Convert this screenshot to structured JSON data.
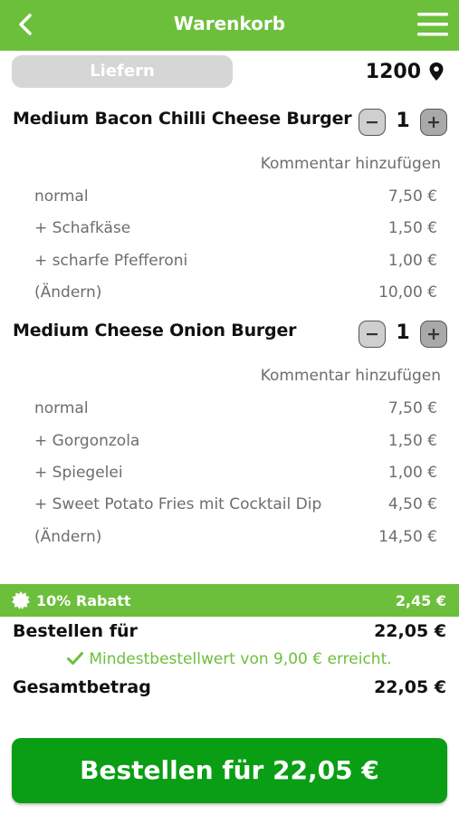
{
  "header": {
    "title": "Warenkorb",
    "back_icon": "chevron-left-icon",
    "menu_icon": "hamburger-menu-icon"
  },
  "delivery": {
    "mode_label": "Liefern",
    "zip": "1200",
    "location_icon": "location-pin-icon"
  },
  "items": [
    {
      "name": "Medium Bacon Chilli Cheese Burger",
      "quantity": "1",
      "comment_label": "Kommentar hinzufügen",
      "lines": [
        {
          "label": "normal",
          "price": "7,50 €"
        },
        {
          "label": "+ Schafkäse",
          "price": "1,50 €"
        },
        {
          "label": "+ scharfe Pfefferoni",
          "price": "1,00 €"
        },
        {
          "label": "(Ändern)",
          "price": "10,00 €"
        }
      ]
    },
    {
      "name": "Medium Cheese Onion Burger",
      "quantity": "1",
      "comment_label": "Kommentar hinzufügen",
      "lines": [
        {
          "label": "normal",
          "price": "7,50 €"
        },
        {
          "label": "+ Gorgonzola",
          "price": "1,50 €"
        },
        {
          "label": "+ Spiegelei",
          "price": "1,00 €"
        },
        {
          "label": "+ Sweet Potato Fries mit Cocktail Dip",
          "price": "4,50 €"
        },
        {
          "label": "(Ändern)",
          "price": "14,50 €"
        }
      ]
    }
  ],
  "discount": {
    "label": "10% Rabatt",
    "value": "2,45 €",
    "icon": "discount-badge-icon"
  },
  "order_for": {
    "label": "Bestellen für",
    "value": "22,05 €"
  },
  "min_order_note": "Mindestbestellwert von 9,00 € erreicht.",
  "total": {
    "label": "Gesamtbetrag",
    "value": "22,05 €"
  },
  "order_button": "Bestellen für 22,05 €",
  "colors": {
    "brand_green": "#6cbf3b",
    "button_green": "#0a9e14",
    "muted_text": "#6d6d6d"
  }
}
